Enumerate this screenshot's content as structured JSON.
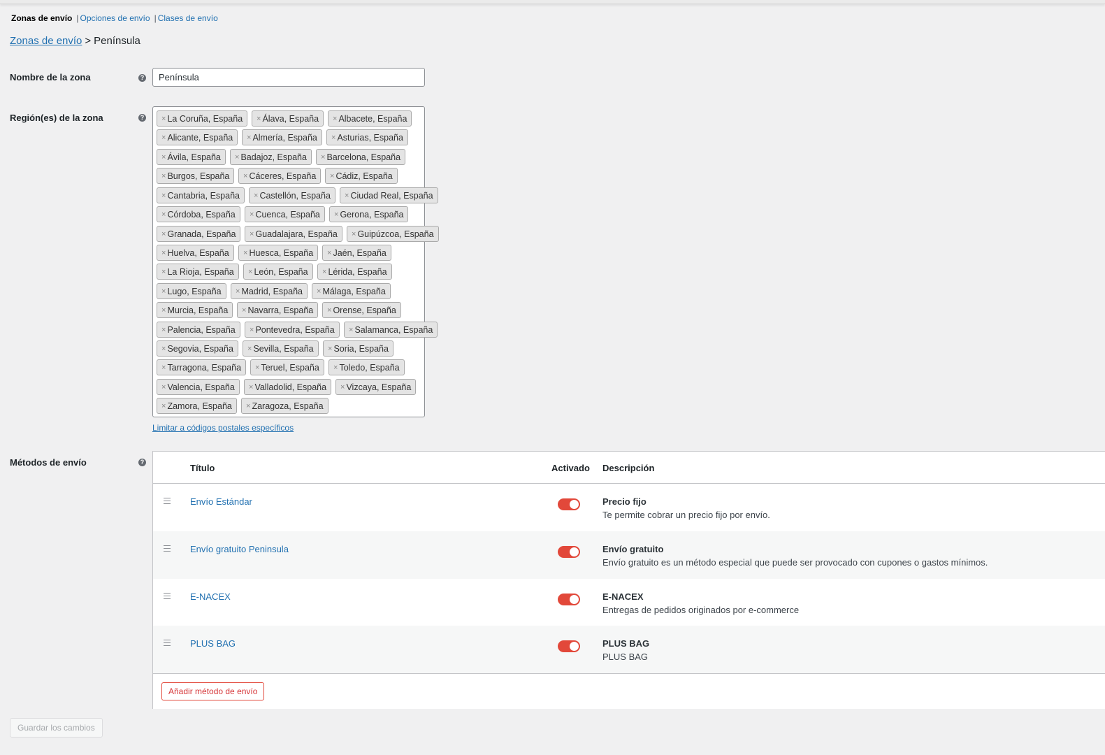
{
  "tabs": {
    "current": "Zonas de envío",
    "options": "Opciones de envío",
    "classes": "Clases de envío"
  },
  "breadcrumb": {
    "parent": "Zonas de envío",
    "separator": ">",
    "current": "Península"
  },
  "form": {
    "zone_name_label": "Nombre de la zona",
    "zone_name_value": "Península",
    "regions_label": "Región(es) de la zona",
    "limit_link": "Limitar a códigos postales específicos",
    "methods_label": "Métodos de envío",
    "help_glyph": "?"
  },
  "regions": [
    "La Coruña, España",
    "Álava, España",
    "Albacete, España",
    "Alicante, España",
    "Almería, España",
    "Asturias, España",
    "Ávila, España",
    "Badajoz, España",
    "Barcelona, España",
    "Burgos, España",
    "Cáceres, España",
    "Cádiz, España",
    "Cantabria, España",
    "Castellón, España",
    "Ciudad Real, España",
    "Córdoba, España",
    "Cuenca, España",
    "Gerona, España",
    "Granada, España",
    "Guadalajara, España",
    "Guipúzcoa, España",
    "Huelva, España",
    "Huesca, España",
    "Jaén, España",
    "La Rioja, España",
    "León, España",
    "Lérida, España",
    "Lugo, España",
    "Madrid, España",
    "Málaga, España",
    "Murcia, España",
    "Navarra, España",
    "Orense, España",
    "Palencia, España",
    "Pontevedra, España",
    "Salamanca, España",
    "Segovia, España",
    "Sevilla, España",
    "Soria, España",
    "Tarragona, España",
    "Teruel, España",
    "Toledo, España",
    "Valencia, España",
    "Valladolid, España",
    "Vizcaya, España",
    "Zamora, España",
    "Zaragoza, España"
  ],
  "methods_table": {
    "headers": {
      "title": "Título",
      "enabled": "Activado",
      "description": "Descripción"
    },
    "rows": [
      {
        "title": "Envío Estándar",
        "enabled": true,
        "desc_title": "Precio fijo",
        "desc_text": "Te permite cobrar un precio fijo por envío."
      },
      {
        "title": "Envío gratuito Peninsula",
        "enabled": true,
        "desc_title": "Envío gratuito",
        "desc_text": "Envío gratuito es un método especial que puede ser provocado con cupones o gastos mínimos."
      },
      {
        "title": "E-NACEX",
        "enabled": true,
        "desc_title": "E-NACEX",
        "desc_text": "Entregas de pedidos originados por e-commerce"
      },
      {
        "title": "PLUS BAG",
        "enabled": true,
        "desc_title": "PLUS BAG",
        "desc_text": "PLUS BAG"
      }
    ],
    "add_button": "Añadir método de envío"
  },
  "save_button": "Guardar los cambios",
  "colors": {
    "link": "#2271b1",
    "toggle_on": "#e2483a",
    "background": "#f0f0f1"
  }
}
